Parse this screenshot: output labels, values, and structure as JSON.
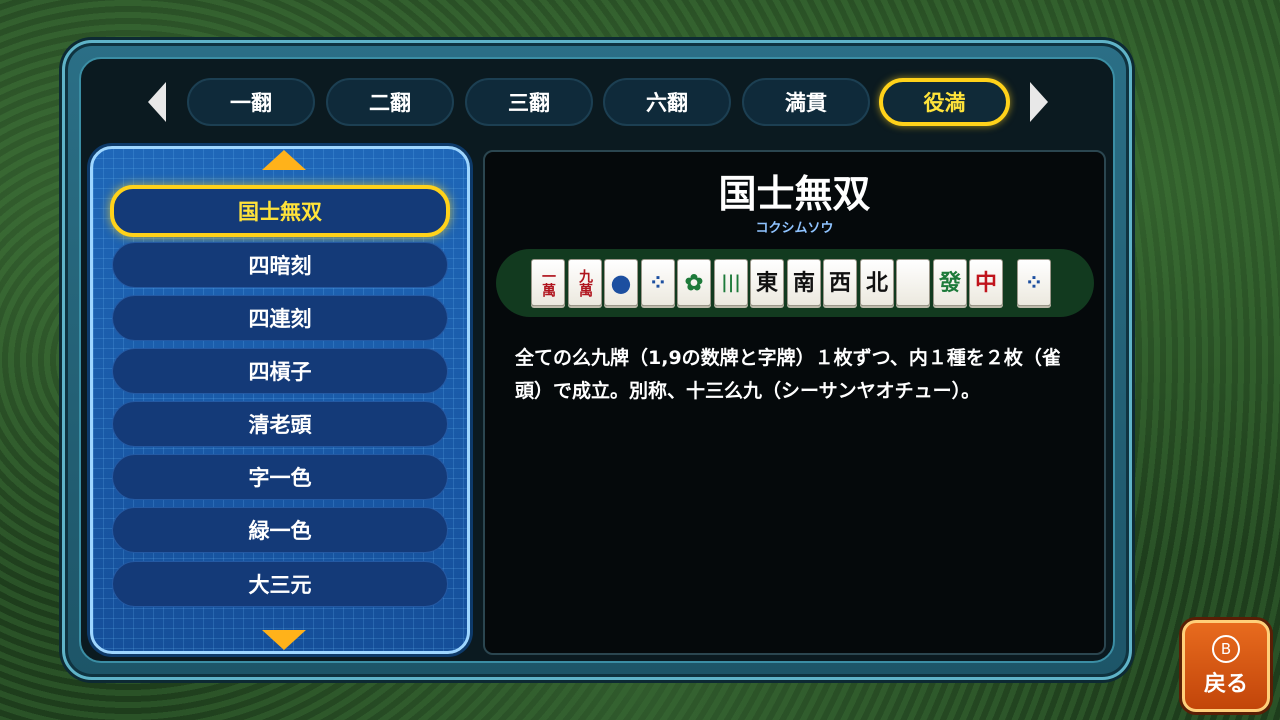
{
  "tabs": [
    {
      "label": "一翻"
    },
    {
      "label": "二翻"
    },
    {
      "label": "三翻"
    },
    {
      "label": "六翻"
    },
    {
      "label": "満貫"
    },
    {
      "label": "役満"
    }
  ],
  "active_tab": "役満",
  "yaku_list": [
    {
      "label": "国士無双"
    },
    {
      "label": "四暗刻"
    },
    {
      "label": "四連刻"
    },
    {
      "label": "四槓子"
    },
    {
      "label": "清老頭"
    },
    {
      "label": "字一色"
    },
    {
      "label": "緑一色"
    },
    {
      "label": "大三元"
    }
  ],
  "selected_yaku": "国士無双",
  "detail": {
    "title": "国士無双",
    "reading": "コクシムソウ",
    "description": "全ての么九牌（1,9の数牌と字牌）１枚ずつ、内１種を２枚（雀頭）で成立。別称、十三么九（シーサンヤオチュー）。"
  },
  "tiles": [
    {
      "name": "1-man-tile",
      "glyph": "一萬"
    },
    {
      "name": "9-man-tile",
      "glyph": "九萬"
    },
    {
      "name": "1-pin-tile",
      "glyph": "●"
    },
    {
      "name": "9-pin-tile",
      "glyph": "⁘"
    },
    {
      "name": "1-sou-tile",
      "glyph": "✿"
    },
    {
      "name": "9-sou-tile",
      "glyph": "|||"
    },
    {
      "name": "east-tile",
      "glyph": "東"
    },
    {
      "name": "south-tile",
      "glyph": "南"
    },
    {
      "name": "west-tile",
      "glyph": "西"
    },
    {
      "name": "north-tile",
      "glyph": "北"
    },
    {
      "name": "white-dragon-tile",
      "glyph": ""
    },
    {
      "name": "green-dragon-tile",
      "glyph": "發"
    },
    {
      "name": "red-dragon-tile",
      "glyph": "中"
    },
    {
      "name": "9-pin-pair-tile",
      "glyph": "⁘"
    }
  ],
  "back_button": {
    "key": "B",
    "label": "戻る"
  },
  "colors": {
    "accent_yellow": "#ffd21a",
    "list_blue": "#1f67b8",
    "back_orange": "#e86b1e"
  }
}
